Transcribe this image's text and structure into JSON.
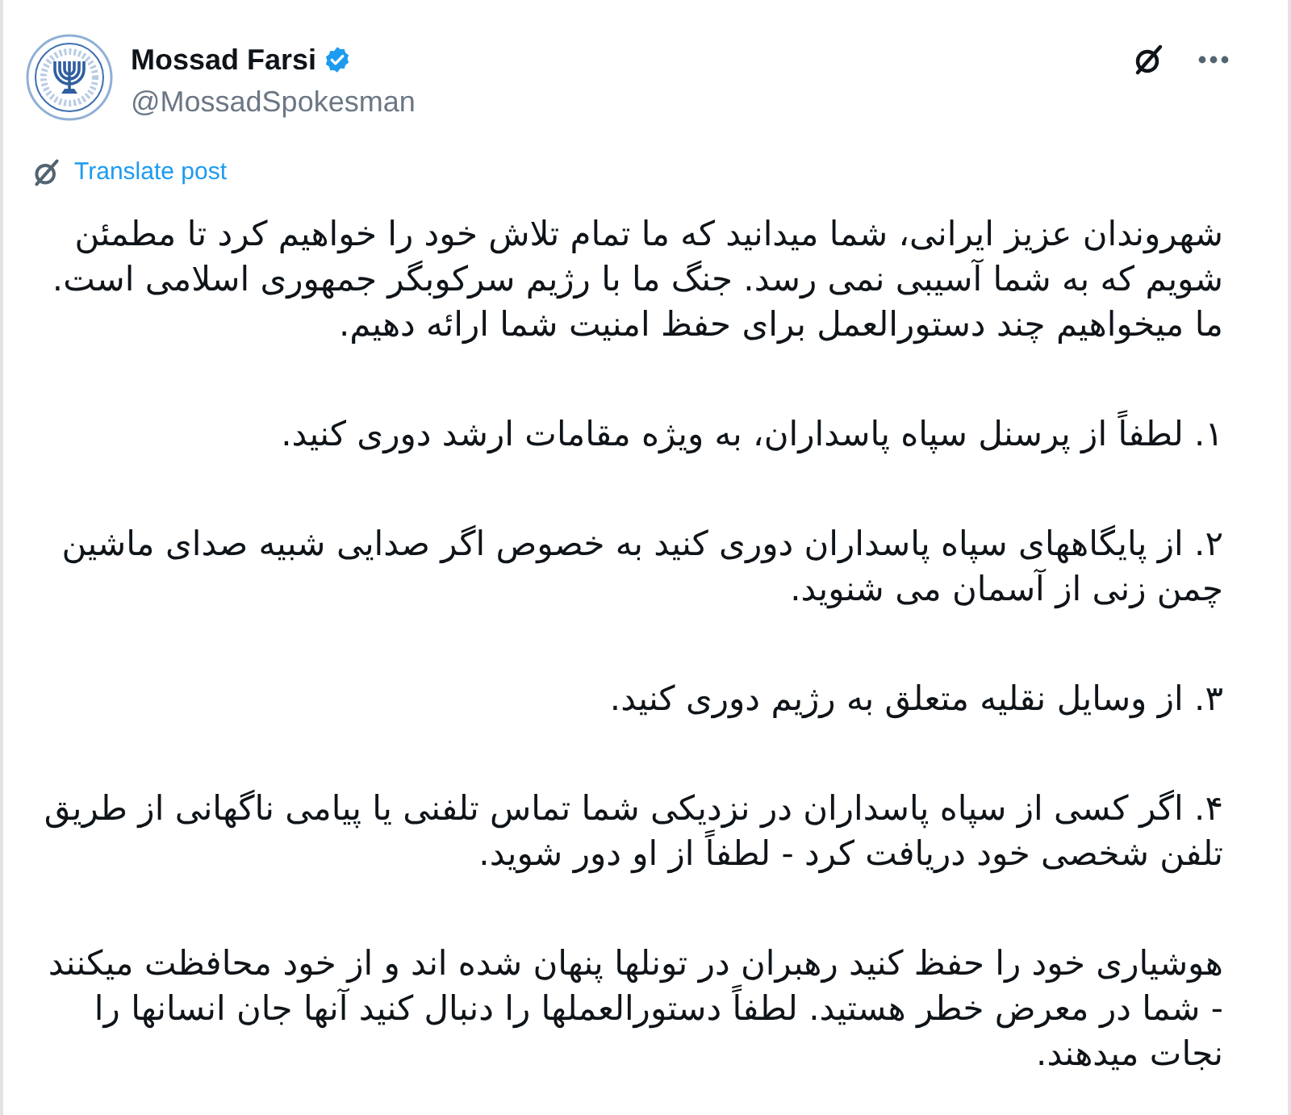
{
  "post": {
    "author": {
      "name": "Mossad Farsi",
      "verified": true,
      "handle": "@MossadSpokesman"
    },
    "translate_link": "Translate post",
    "paragraphs": [
      "شهروندان عزیز ایرانی، شما میدانید که ما تمام تلاش خود را خواهیم کرد تا مطمئن شویم که به شما آسیبی نمی رسد. جنگ ما با رژیم سرکوبگر جمهوری اسلامی است. ما میخواهیم چند دستورالعمل برای حفظ امنیت شما ارائه دهیم.",
      "۱. لطفاً از پرسنل سپاه پاسداران، به ویژه مقامات ارشد دوری کنید.",
      "۲. از پایگاههای سپاه پاسداران دوری کنید به خصوص اگر صدایی شبیه صدای ماشین چمن زنی از آسمان می شنوید.",
      "۳. از وسایل نقلیه متعلق به رژیم دوری کنید.",
      "۴.  اگر کسی از سپاه پاسداران در نزدیکی شما تماس تلفنی یا پیامی ناگهانی از طریق تلفن شخصی خود دریافت کرد - لطفاً از او دور شوید.",
      "هوشیاری خود را حفظ کنید رهبران در تونلها پنهان شده اند و از خود محافظت میکنند - شما در معرض خطر هستید. لطفاً دستورالعملها را دنبال کنید آنها جان انسانها را نجات میدهند."
    ]
  }
}
